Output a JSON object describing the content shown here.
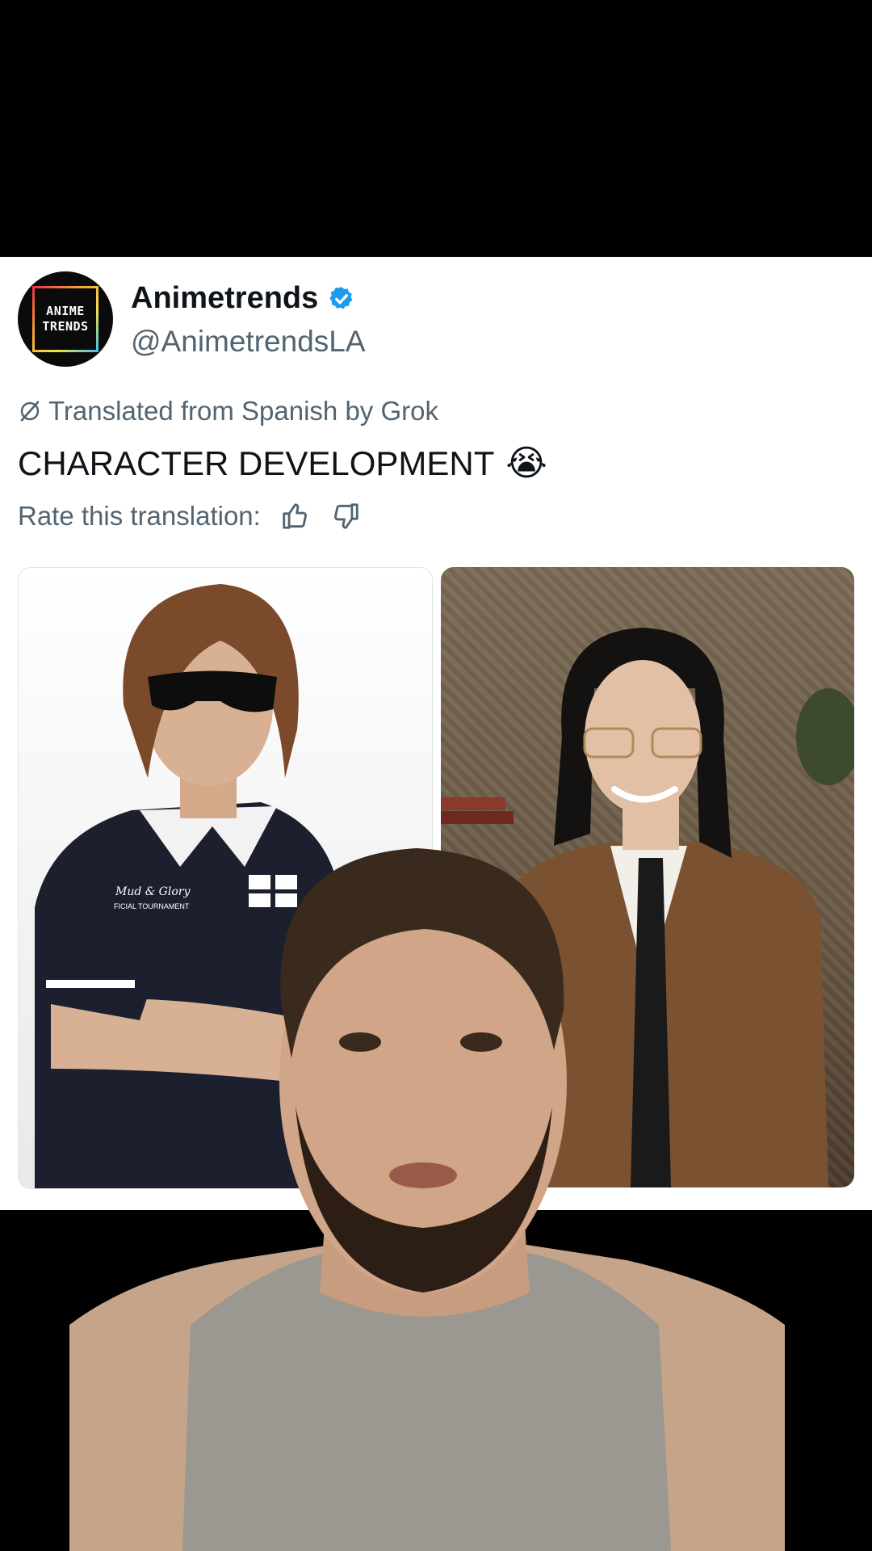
{
  "tweet": {
    "display_name": "Animetrends",
    "handle": "@AnimetrendsLA",
    "avatar_line1": "ANIME",
    "avatar_line2": "TRENDS",
    "translated_note": "Translated from Spanish by Grok",
    "text": "CHARACTER DEVELOPMENT",
    "emoji": "😭",
    "rate_label": "Rate this translation:",
    "verified_color": "#1d9bf0",
    "icons": [
      "verified-badge-icon",
      "grok-icon",
      "thumbs-up-icon",
      "thumbs-down-icon"
    ]
  },
  "media": {
    "left_shirt_text": "Mud & Glory",
    "left_shirt_subtext": "FICIAL TOURNAMENT"
  }
}
